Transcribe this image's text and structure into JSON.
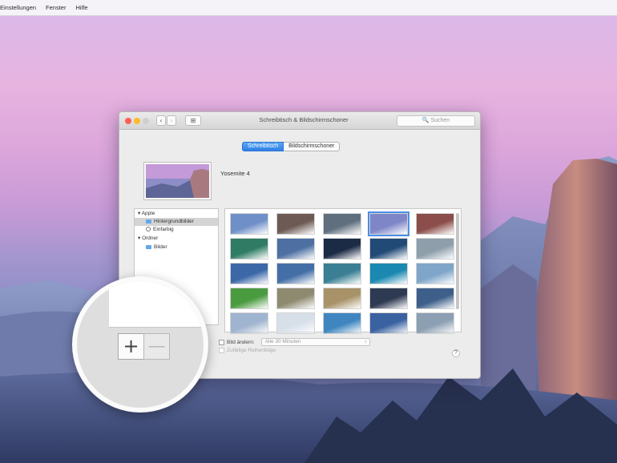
{
  "menubar": {
    "items": [
      "Einstellungen",
      "Fenster",
      "Hilfe"
    ]
  },
  "window": {
    "title": "Schreibtisch & Bildschirmschoner",
    "nav": {
      "back": "‹",
      "forward": "›",
      "grid": "⊞"
    },
    "search_placeholder": "Suchen",
    "tabs": [
      {
        "label": "Schreibtisch",
        "active": true
      },
      {
        "label": "Bildschirmschoner",
        "active": false
      }
    ],
    "preview_name": "Yosemite 4",
    "sidebar": {
      "groups": [
        {
          "label": "Apple",
          "items": [
            "Hintergrundbilder",
            "Einfarbig"
          ]
        },
        {
          "label": "Ordner",
          "items": [
            "Bilder"
          ]
        }
      ]
    },
    "change_picture_label": "Bild ändern:",
    "interval_value": "Alle 30 Minuten",
    "random_order_label": "Zufällige Reihenfolge",
    "help": "?",
    "selected_thumbnail": 3,
    "thumbnails": [
      "#6f8fc8",
      "#6e5a54",
      "#5f6f7e",
      "#7f86c8",
      "#8b4e4a",
      "#2f7b63",
      "#4d6fa2",
      "#1b2a45",
      "#214a76",
      "#8e9fab",
      "#3c68a8",
      "#446fa6",
      "#3a7f93",
      "#1a88b0",
      "#7fa6c9",
      "#4a9b40",
      "#8e8a70",
      "#a89268",
      "#2e3a52",
      "#3d5f8a",
      "#9fb4cf",
      "#d7dfe8",
      "#3f86c0",
      "#3a62a0",
      "#8c9fb3"
    ]
  },
  "magnifier": {
    "plus": "+",
    "minus": "—"
  }
}
